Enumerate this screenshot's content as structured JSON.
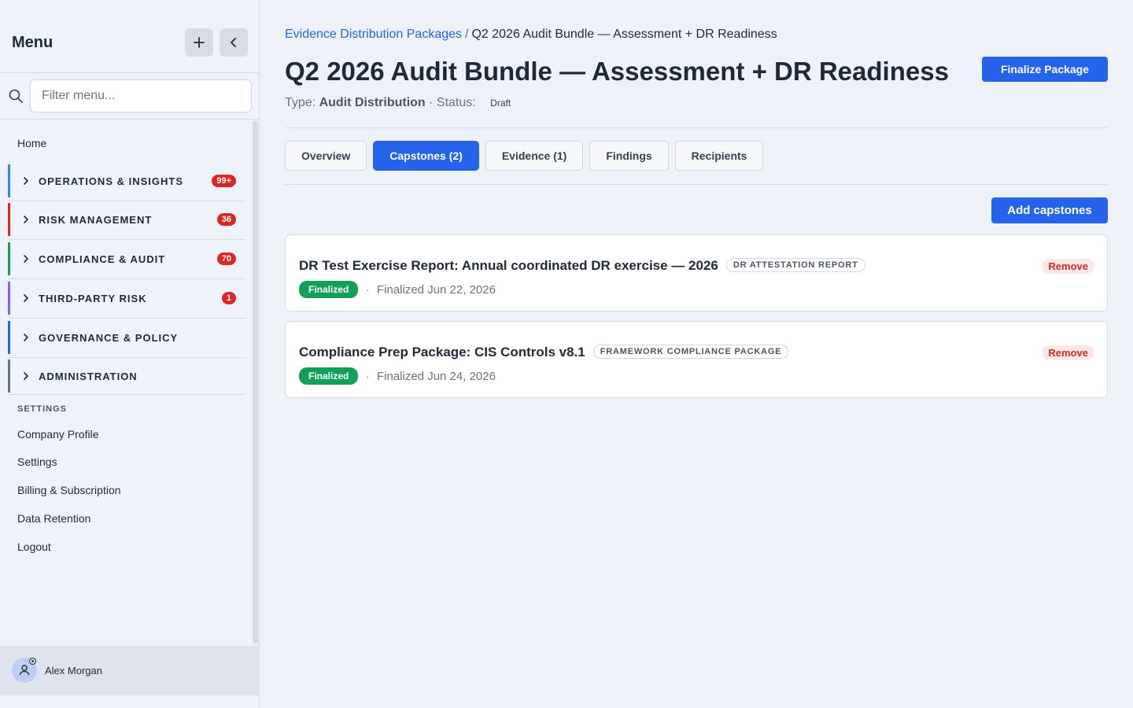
{
  "sidebar": {
    "title": "Menu",
    "search_placeholder": "Filter menu...",
    "home_label": "Home",
    "groups": [
      {
        "label": "OPERATIONS & INSIGHTS",
        "badge": "99+",
        "color": "#3b82f6"
      },
      {
        "label": "RISK MANAGEMENT",
        "badge": "36",
        "color": "#dc2626"
      },
      {
        "label": "COMPLIANCE & AUDIT",
        "badge": "70",
        "color": "#10a05a"
      },
      {
        "label": "THIRD-PARTY RISK",
        "badge": "1",
        "color": "#8b5cf6"
      },
      {
        "label": "GOVERNANCE & POLICY",
        "badge": "",
        "color": "#2563eb"
      },
      {
        "label": "ADMINISTRATION",
        "badge": "",
        "color": "#6b7280"
      }
    ],
    "settings_heading": "SETTINGS",
    "settings_items": [
      "Company Profile",
      "Settings",
      "Billing & Subscription",
      "Data Retention",
      "Logout"
    ],
    "user_name": "Alex Morgan"
  },
  "breadcrumb": {
    "parent": "Evidence Distribution Packages",
    "separator": "/",
    "current": "Q2 2026 Audit Bundle — Assessment + DR Readiness"
  },
  "page": {
    "title": "Q2 2026 Audit Bundle — Assessment + DR Readiness",
    "type_label": "Type:",
    "type_value": "Audit Distribution",
    "status_label": "· Status:",
    "status_value": "Draft",
    "finalize_button": "Finalize Package"
  },
  "tabs": [
    {
      "label": "Overview",
      "active": false
    },
    {
      "label": "Capstones (2)",
      "active": true
    },
    {
      "label": "Evidence (1)",
      "active": false
    },
    {
      "label": "Findings",
      "active": false
    },
    {
      "label": "Recipients",
      "active": false
    }
  ],
  "add_button": "Add capstones",
  "capstones": [
    {
      "title": "DR Test Exercise Report: Annual coordinated DR exercise — 2026",
      "type_tag": "DR ATTESTATION REPORT",
      "status": "Finalized",
      "separator": "·",
      "date": "Finalized Jun 22, 2026",
      "remove_label": "Remove"
    },
    {
      "title": "Compliance Prep Package: CIS Controls v8.1",
      "type_tag": "FRAMEWORK COMPLIANCE PACKAGE",
      "status": "Finalized",
      "separator": "·",
      "date": "Finalized Jun 24, 2026",
      "remove_label": "Remove"
    }
  ],
  "colors": {
    "accent": "#2563eb",
    "danger": "#dc2626",
    "success": "#10a05a"
  }
}
